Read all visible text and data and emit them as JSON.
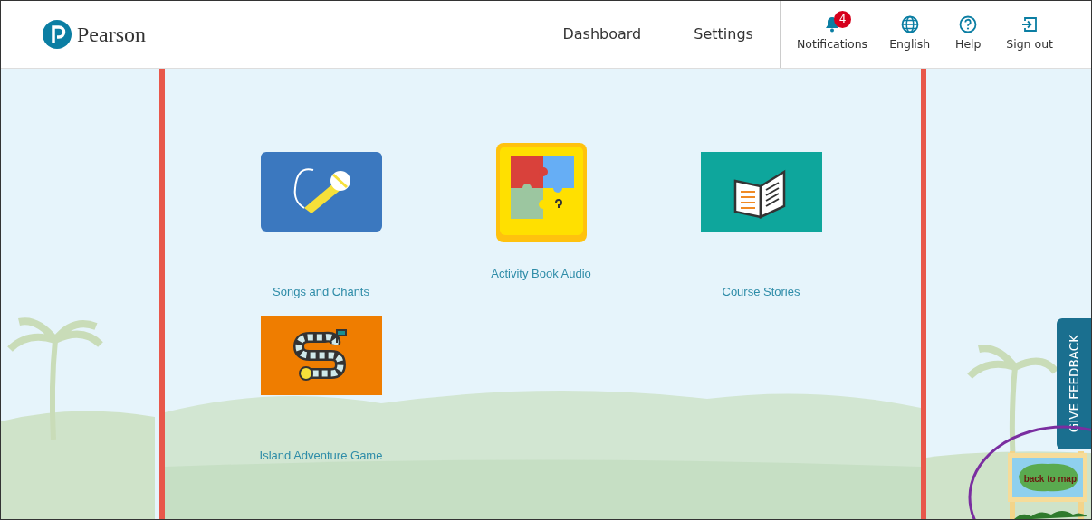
{
  "header": {
    "logo": "Pearson",
    "nav": [
      {
        "label": "Dashboard"
      },
      {
        "label": "Settings"
      }
    ],
    "actions": [
      {
        "kind": "bell",
        "label": "Notifications",
        "badge": "4"
      },
      {
        "kind": "globe",
        "label": "English"
      },
      {
        "kind": "help",
        "label": "Help"
      },
      {
        "kind": "signout",
        "label": "Sign out"
      }
    ]
  },
  "tiles": [
    {
      "kind": "microphone",
      "label": "Songs and Chants"
    },
    {
      "kind": "puzzle",
      "label": "Activity Book Audio"
    },
    {
      "kind": "book",
      "label": "Course Stories"
    },
    {
      "kind": "boardgame",
      "label": "Island Adventure Game"
    }
  ],
  "feedback": {
    "label": "GIVE FEEDBACK"
  },
  "map_sign": {
    "label": "back to map"
  }
}
